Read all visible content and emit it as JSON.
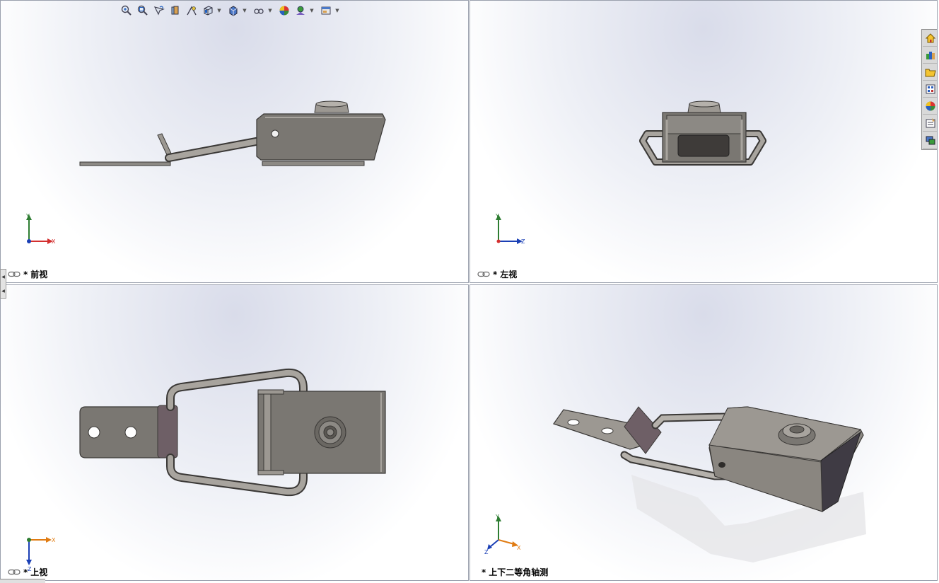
{
  "viewports": {
    "front": {
      "label": "前视",
      "axes": {
        "vertical": "Y",
        "horizontal": "X"
      }
    },
    "left": {
      "label": "左视",
      "axes": {
        "vertical": "Y",
        "horizontal": "Z"
      }
    },
    "top": {
      "label": "上视",
      "axes": {
        "vertical": "Z",
        "horizontal": "X"
      }
    },
    "iso": {
      "label": "上下二等角轴测",
      "axes": {
        "vertical": "Y",
        "horizontal": "X",
        "depth": "Z"
      }
    }
  },
  "label_prefix": "*",
  "colors": {
    "part_body": "#7a7772",
    "part_edge": "#3a3836",
    "part_light": "#9c9892",
    "axis_x": "#d32f2f",
    "axis_y": "#2e7d32",
    "axis_z": "#1a3fb5",
    "axis_orange": "#e07b12"
  },
  "toolbar_icons": [
    "zoom-to-fit-icon",
    "zoom-area-icon",
    "previous-view-icon",
    "section-view-icon",
    "dynamic-annotation-icon",
    "view-orientation-icon",
    "display-style-icon",
    "hide-show-icon",
    "edit-appearance-icon",
    "apply-scene-icon",
    "view-settings-icon"
  ],
  "taskpane_icons": [
    "solidworks-resources-icon",
    "design-library-icon",
    "file-explorer-icon",
    "view-palette-icon",
    "appearances-icon",
    "custom-properties-icon",
    "solidworks-forum-icon"
  ]
}
